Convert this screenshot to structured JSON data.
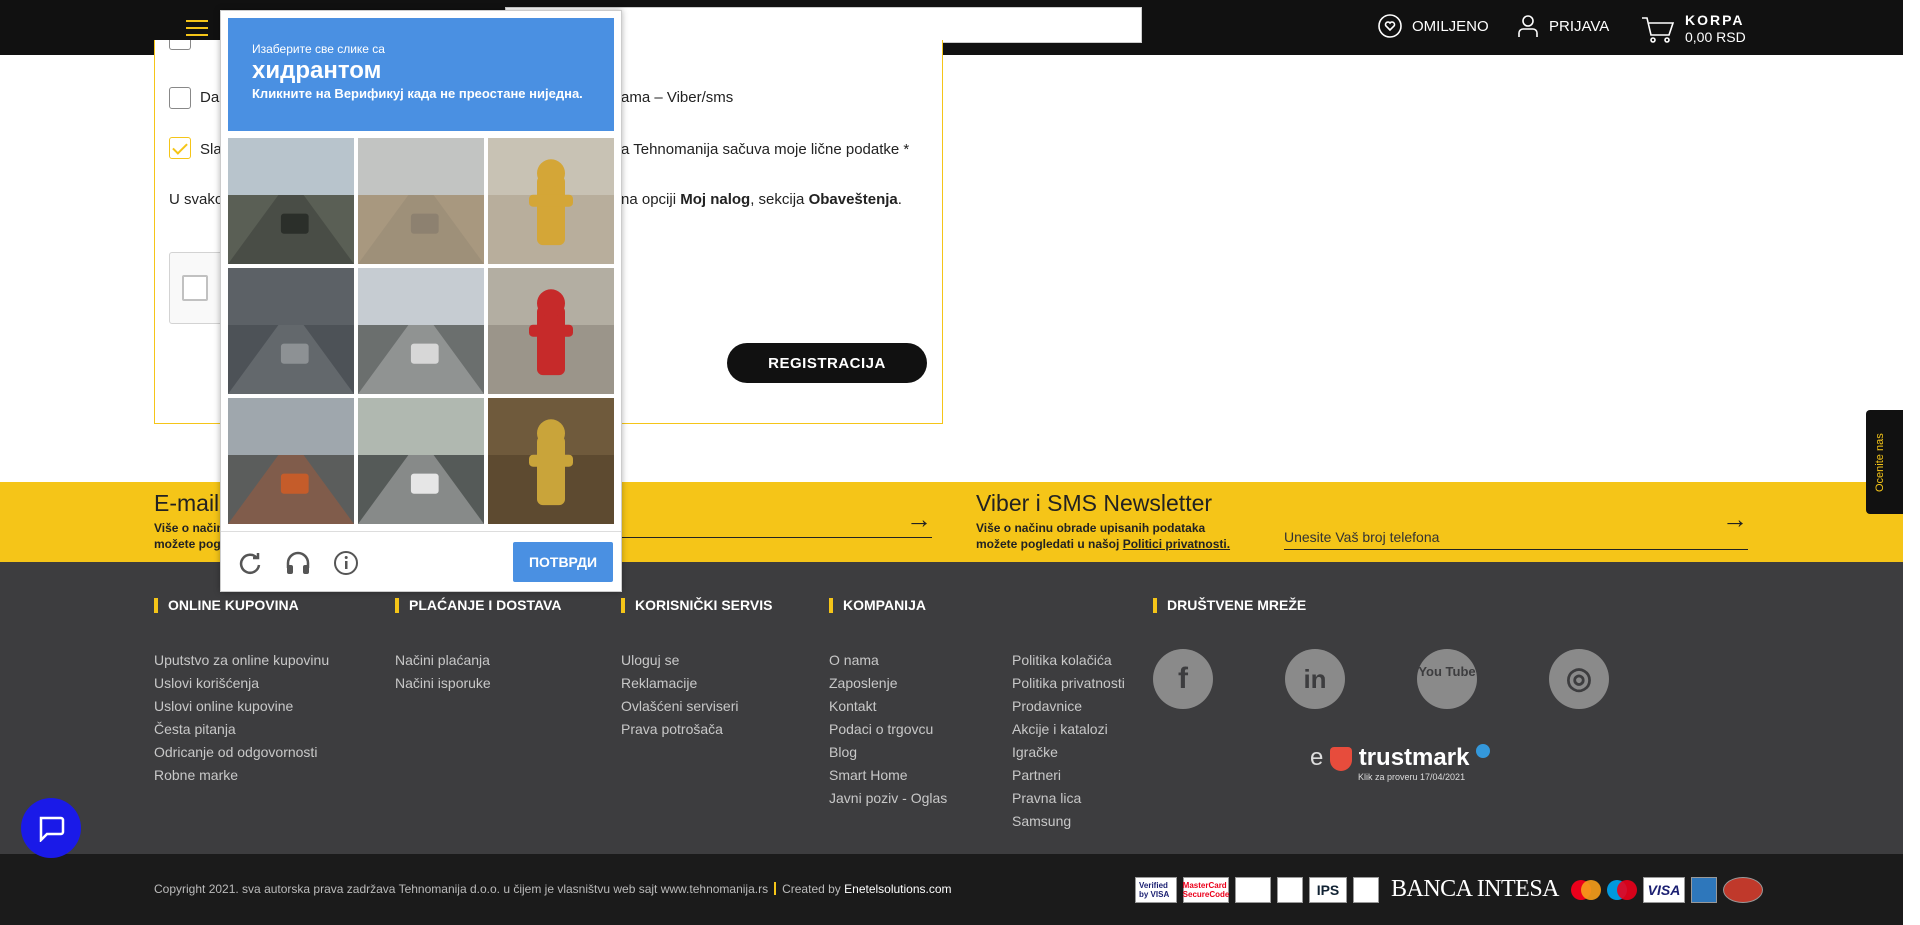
{
  "header": {
    "favorites_label": "OMILJENO",
    "login_label": "PRIJAVA",
    "cart_label": "KORPA",
    "cart_total": "0,00 RSD"
  },
  "form": {
    "consent_viber_prefix": "Da,",
    "consent_viber_suffix": "ama – Viber/sms",
    "consent_data_prefix": "Sla",
    "consent_data_suffix": "a Tehnomanija sačuva moje lične podatke *",
    "notice_prefix": "U svako",
    "notice_suffix_1": "na opciji ",
    "notice_bold_1": "Moj nalog",
    "notice_suffix_2": ", sekcija ",
    "notice_bold_2": "Obaveštenja",
    "notice_end": ".",
    "register_button": "REGISTRACIJA"
  },
  "recaptcha": {
    "instruction_line1": "Изаберите све слике са",
    "target_object": "хидрантом",
    "instruction_line2": "Кликните на Верификуј када не преостане ниједна.",
    "verify_button": "ПОТВРДИ",
    "tiles": [
      {
        "scene": "street-traffic-light",
        "sky": "#b8c4cc",
        "ground": "#5a5f55",
        "accent": "#2b2f2a"
      },
      {
        "scene": "empty-road",
        "sky": "#c2c4c2",
        "ground": "#a8987f",
        "accent": "#8d8170"
      },
      {
        "scene": "yellow-hydrant",
        "sky": "#c8c2b4",
        "ground": "#b8ae9c",
        "accent": "#d4a637"
      },
      {
        "scene": "crosswalk",
        "sky": "#5c6166",
        "ground": "#4d5257",
        "accent": "#8d9194"
      },
      {
        "scene": "road-cars",
        "sky": "#c6ccd2",
        "ground": "#6b6f6e",
        "accent": "#d7d7d7"
      },
      {
        "scene": "red-hydrant",
        "sky": "#b3aea2",
        "ground": "#9b958a",
        "accent": "#c62a2a"
      },
      {
        "scene": "busy-street",
        "sky": "#9fa7ad",
        "ground": "#5b5d5c",
        "accent": "#c55c2a"
      },
      {
        "scene": "highway-car",
        "sky": "#b0b8b0",
        "ground": "#555a58",
        "accent": "#e6e6e6"
      },
      {
        "scene": "yellow-hydrant-closeup",
        "sky": "#6f5a3c",
        "ground": "#5d4a30",
        "accent": "#c9a43a"
      }
    ]
  },
  "newsletter": {
    "email_title": "E-mail",
    "email_desc_line1": "Više o način",
    "email_desc_line2": "možete pogle",
    "viber_title": "Viber i SMS Newsletter",
    "viber_desc_line1": "Više o načinu obrade upisanih podataka",
    "viber_desc_line2": "možete pogledati u našoj ",
    "viber_policy_link": "Politici privatnosti.",
    "viber_input_placeholder": "Unesite Vaš broj telefona"
  },
  "footer": {
    "col1": {
      "title": "ONLINE KUPOVINA",
      "links": [
        "Uputstvo za online kupovinu",
        "Uslovi korišćenja",
        "Uslovi online kupovine",
        "Česta pitanja",
        "Odricanje od odgovornosti",
        "Robne marke"
      ]
    },
    "col2": {
      "title": "PLAĆANJE I DOSTAVA",
      "links": [
        "Načini plaćanja",
        "Načini isporuke"
      ]
    },
    "col3": {
      "title": "KORISNIČKI SERVIS",
      "links": [
        "Uloguj se",
        "Reklamacije",
        "Ovlašćeni serviseri",
        "Prava potrošača"
      ]
    },
    "col4": {
      "title": "KOMPANIJA",
      "links": [
        "O nama",
        "Zaposlenje",
        "Kontakt",
        "Podaci o trgovcu",
        "Blog",
        "Smart Home",
        "Javni poziv - Oglas"
      ]
    },
    "col5": {
      "links": [
        "Politika kolačića",
        "Politika privatnosti",
        "Prodavnice",
        "Akcije i katalozi",
        "Igračke",
        "Partneri",
        "Pravna lica",
        "Samsung"
      ]
    },
    "social": {
      "title": "DRUŠTVENE MREŽE",
      "facebook": "f",
      "linkedin": "in",
      "youtube": "You Tube",
      "instagram": "◎"
    },
    "trustmark_prefix": "e",
    "trustmark_main": "trustmark",
    "trustmark_sub": "Klik za proveru 17/04/2021"
  },
  "bottom": {
    "copyright": "Copyright 2021. sva autorska prava zadržava Tehnomanija d.o.o. u čijem je vlasništvu web sajt www.tehnomanija.rs",
    "created_by": "Created by ",
    "created_link": "Enetelsolutions.com",
    "verified_visa": "Verified by VISA",
    "mastercard_secure": "MasterCard SecureCode",
    "ips": "IPS",
    "banca_intesa": "BANCA INTESA",
    "visa": "VISA"
  },
  "rating_tab": "Ocenite nas",
  "colors": {
    "brand_yellow": "#f5c518",
    "header_black": "#111111",
    "footer_grey": "#3d3d3f",
    "recaptcha_blue": "#4a90e2"
  }
}
